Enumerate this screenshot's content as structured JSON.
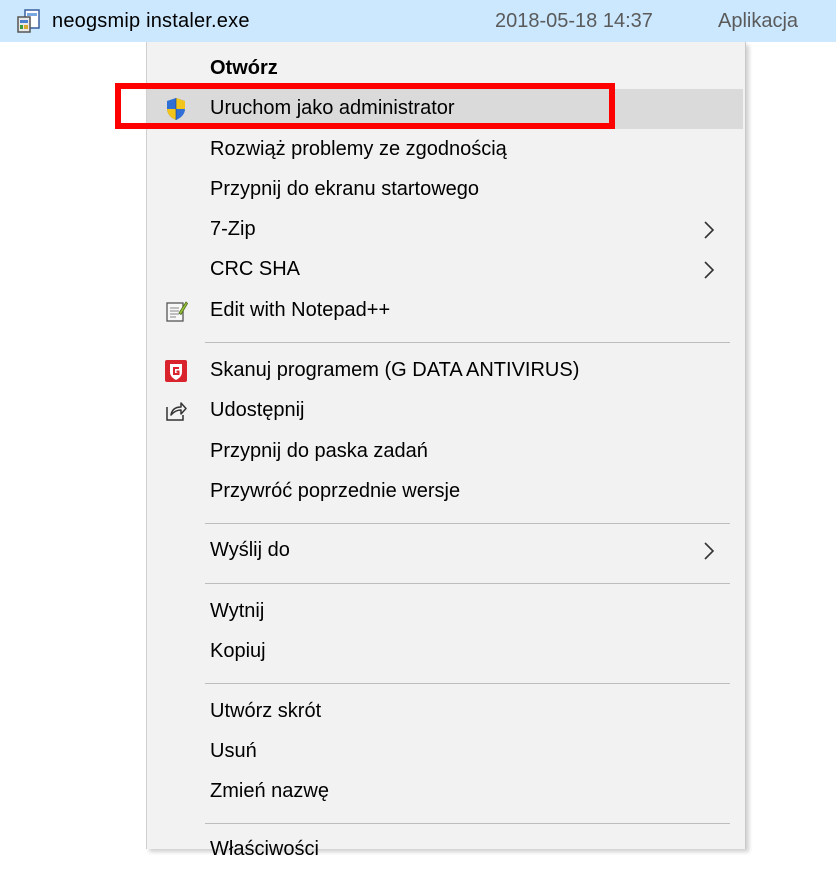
{
  "file": {
    "name": "neogsmip instaler.exe",
    "date": "2018-05-18 14:37",
    "type": "Aplikacja",
    "icon": "installer-icon"
  },
  "menu": {
    "open": "Otwórz",
    "run_as_admin": "Uruchom jako administrator",
    "troubleshoot": "Rozwiąż problemy ze zgodnością",
    "pin_start": "Przypnij do ekranu startowego",
    "seven_zip": "7-Zip",
    "crc_sha": "CRC SHA",
    "notepadpp": "Edit with Notepad++",
    "gdata_scan": "Skanuj programem (G DATA ANTIVIRUS)",
    "share": "Udostępnij",
    "pin_taskbar": "Przypnij do paska zadań",
    "restore_versions": "Przywróć poprzednie wersje",
    "send_to": "Wyślij do",
    "cut": "Wytnij",
    "copy": "Kopiuj",
    "create_shortcut": "Utwórz skrót",
    "delete": "Usuń",
    "rename": "Zmień nazwę",
    "properties": "Właściwości"
  },
  "colors": {
    "selection_bg": "#cce8ff",
    "menu_bg": "#f2f2f2",
    "hover_bg": "#dadada",
    "highlight": "#ff0000"
  }
}
